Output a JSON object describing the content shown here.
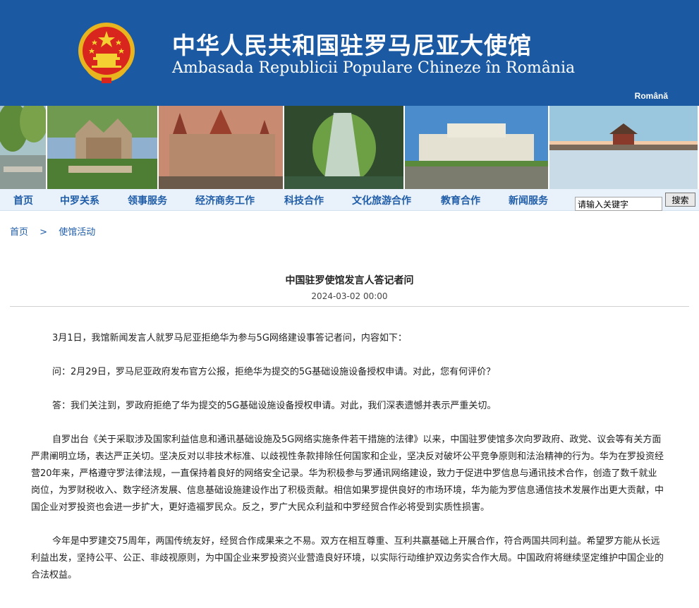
{
  "header": {
    "title_cn": "中华人民共和国驻罗马尼亚大使馆",
    "title_ro": "Ambasada Republicii Populare Chineze în România",
    "language_link": "Română"
  },
  "nav": {
    "items": [
      "首页",
      "中罗关系",
      "领事服务",
      "经济商务工作",
      "科技合作",
      "文化旅游合作",
      "教育合作",
      "新闻服务"
    ]
  },
  "search": {
    "placeholder": "请输入关键字",
    "button_label": "搜索"
  },
  "breadcrumb": {
    "home": "首页",
    "separator": ">",
    "section": "使馆活动"
  },
  "article": {
    "title": "中国驻罗使馆发言人答记者问",
    "date": "2024-03-02 00:00",
    "paragraphs": [
      "3月1日，我馆新闻发言人就罗马尼亚拒绝华为参与5G网络建设事答记者问，内容如下：",
      "问：2月29日，罗马尼亚政府发布官方公报，拒绝华为提交的5G基础设施设备授权申请。对此，您有何评价？",
      "答：我们关注到，罗政府拒绝了华为提交的5G基础设施设备授权申请。对此，我们深表遗憾并表示严重关切。",
      "自罗出台《关于采取涉及国家利益信息和通讯基础设施及5G网络实施条件若干措施的法律》以来，中国驻罗使馆多次向罗政府、政党、议会等有关方面严肃阐明立场，表达严正关切。坚决反对以非技术标准、以歧视性条款排除任何国家和企业，坚决反对破坏公平竞争原则和法治精神的行为。华为在罗投资经营20年来，严格遵守罗法律法规，一直保持着良好的网络安全记录。华为积极参与罗通讯网络建设，致力于促进中罗信息与通讯技术合作，创造了数千就业岗位，为罗财税收入、数字经济发展、信息基础设施建设作出了积极贡献。相信如果罗提供良好的市场环境，华为能为罗信息通信技术发展作出更大贡献，中国企业对罗投资也会进一步扩大，更好造福罗民众。反之，罗广大民众利益和中罗经贸合作必将受到实质性损害。",
      "今年是中罗建交75周年，两国传统友好，经贸合作成果来之不易。双方在相互尊重、互利共赢基础上开展合作，符合两国共同利益。希望罗方能从长远利益出发，坚持公平、公正、非歧视原则，为中国企业来罗投资兴业营造良好环境，以实际行动维护双边务实合作大局。中国政府将继续坚定维护中国企业的合法权益。"
    ]
  },
  "colors": {
    "header_bg": "#1b5aa2",
    "nav_bg": "#e9f1fa",
    "link": "#1f5da8"
  }
}
